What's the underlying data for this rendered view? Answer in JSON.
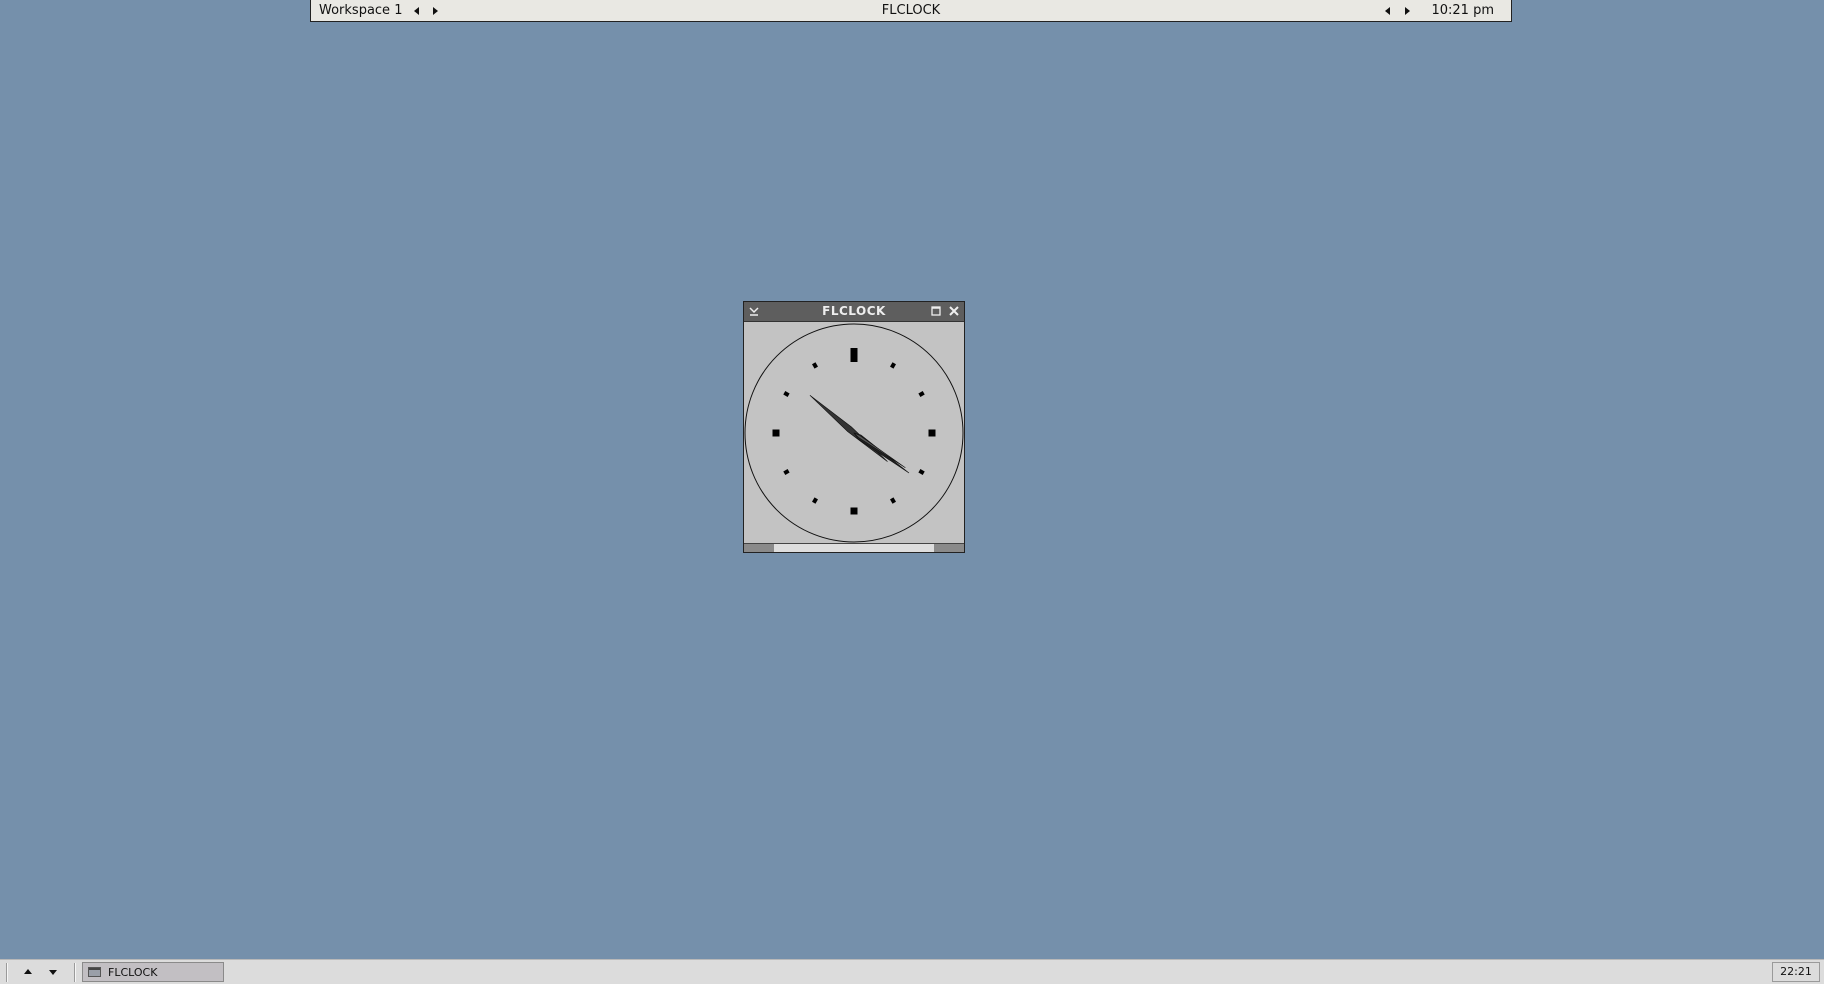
{
  "toolbar": {
    "workspace_label": "Workspace 1",
    "window_title": "FLCLOCK",
    "clock": "10:21 pm"
  },
  "clock_window": {
    "title": "FLCLOCK",
    "time": {
      "hour": 10,
      "minute": 21
    }
  },
  "taskbar": {
    "task_label": "FLCLOCK",
    "tray_clock": "22:21"
  },
  "colors": {
    "desktop": "#7590ab",
    "clock_face": "#c3c3c3",
    "titlebar": "#5e5e5e"
  }
}
